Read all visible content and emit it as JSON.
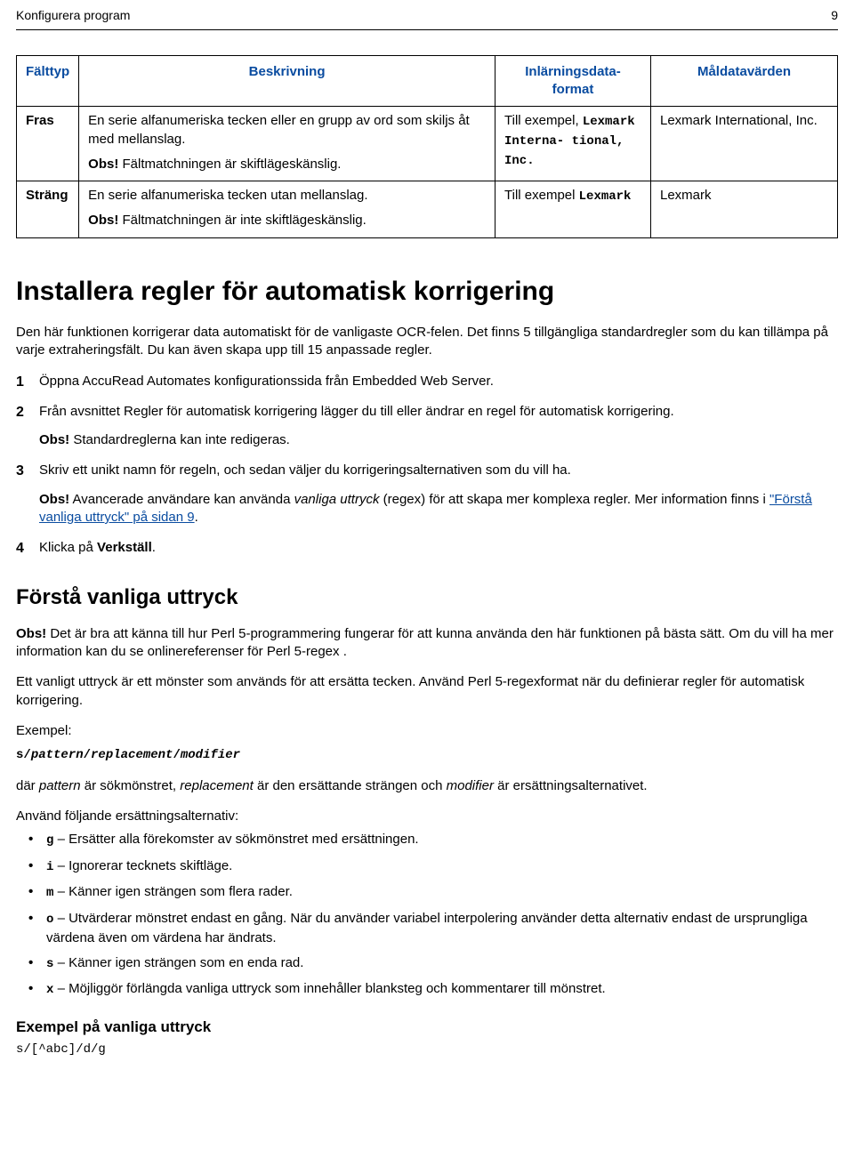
{
  "header": {
    "left": "Konfigurera program",
    "right": "9"
  },
  "table": {
    "headers": {
      "falttyp": "Fälttyp",
      "beskriv": "Beskrivning",
      "inl": "Inlärningsdata-\nformat",
      "mal": "Måldatavärden"
    },
    "row_fras": {
      "falttyp": "Fras",
      "beskriv_line1": "En serie alfanumeriska tecken eller en grupp av ord som skiljs åt med mellanslag.",
      "beskriv_obs_label": "Obs!",
      "beskriv_obs_text": " Fältmatchningen är skiftlägeskänslig.",
      "inl_prefix": "Till exempel, ",
      "inl_mono": "Lexmark Interna- tional, Inc.",
      "mal": "Lexmark International, Inc."
    },
    "row_strang": {
      "falttyp": "Sträng",
      "beskriv_line1": "En serie alfanumeriska tecken utan mellanslag.",
      "beskriv_obs_label": "Obs!",
      "beskriv_obs_text": " Fältmatchningen är inte skiftlägeskänslig.",
      "inl_prefix": "Till exempel ",
      "inl_mono": "Lexmark",
      "mal": "Lexmark"
    }
  },
  "section1": {
    "heading": "Installera regler för automatisk korrigering",
    "intro": "Den här funktionen korrigerar data automatiskt för de vanligaste OCR-felen. Det finns 5 tillgängliga standardregler som du kan tillämpa på varje extraheringsfält. Du kan även skapa upp till 15 anpassade regler.",
    "step1": "Öppna AccuRead Automates konfigurationssida från Embedded Web Server.",
    "step2": "Från avsnittet Regler för automatisk korrigering lägger du till eller ändrar en regel för automatisk korrigering.",
    "step2_obs_label": "Obs!",
    "step2_obs_text": " Standardreglerna kan inte redigeras.",
    "step3": "Skriv ett unikt namn för regeln, och sedan väljer du korrigeringsalternativen som du vill ha.",
    "step3_obs_label": "Obs!",
    "step3_obs_pre": " Avancerade användare kan använda ",
    "step3_obs_em": "vanliga uttryck",
    "step3_obs_mid": " (regex) för att skapa mer komplexa regler. Mer information finns i ",
    "step3_link": "\"Förstå vanliga uttryck\" på sidan 9",
    "step3_obs_post": ".",
    "step4_pre": "Klicka på ",
    "step4_bold": "Verkställ",
    "step4_post": "."
  },
  "section2": {
    "heading": "Förstå vanliga uttryck",
    "obs_label": "Obs!",
    "obs_text": " Det är bra att känna till hur Perl 5-programmering fungerar för att kunna använda den här funktionen på bästa sätt. Om du vill ha mer information kan du se onlinereferenser för Perl 5-regex .",
    "p2": "Ett vanligt uttryck är ett mönster som används för att ersätta tecken. Använd Perl 5-regexformat när du definierar regler för automatisk korrigering.",
    "example_label": "Exempel:",
    "code_s": "s/",
    "code_pattern": "pattern",
    "code_sep1": "/",
    "code_repl": "replacement",
    "code_sep2": "/",
    "code_mod": "modifier",
    "def_pre": "där ",
    "def_pattern": "pattern",
    "def_mid1": " är sökmönstret, ",
    "def_repl": "replacement",
    "def_mid2": " är den ersättande strängen och ",
    "def_mod": "modifier",
    "def_post": " är ersättningsalternativet.",
    "use_following": "Använd följande ersättningsalternativ:",
    "bullets": {
      "g_code": "g",
      "g_text": " – Ersätter alla förekomster av sökmönstret med ersättningen.",
      "i_code": "i",
      "i_text": " – Ignorerar tecknets skiftläge.",
      "m_code": "m",
      "m_text": " – Känner igen strängen som flera rader.",
      "o_code": "o",
      "o_text": " – Utvärderar mönstret endast en gång. När du använder variabel interpolering använder detta alternativ endast de ursprungliga värdena även om värdena har ändrats.",
      "s_code": "s",
      "s_text": " – Känner igen strängen som en enda rad.",
      "x_code": "x",
      "x_text": " – Möjliggör förlängda vanliga uttryck som innehåller blanksteg och kommentarer till mönstret."
    },
    "example_heading": "Exempel på vanliga uttryck",
    "example_code": "s/[^abc]/d/g"
  }
}
